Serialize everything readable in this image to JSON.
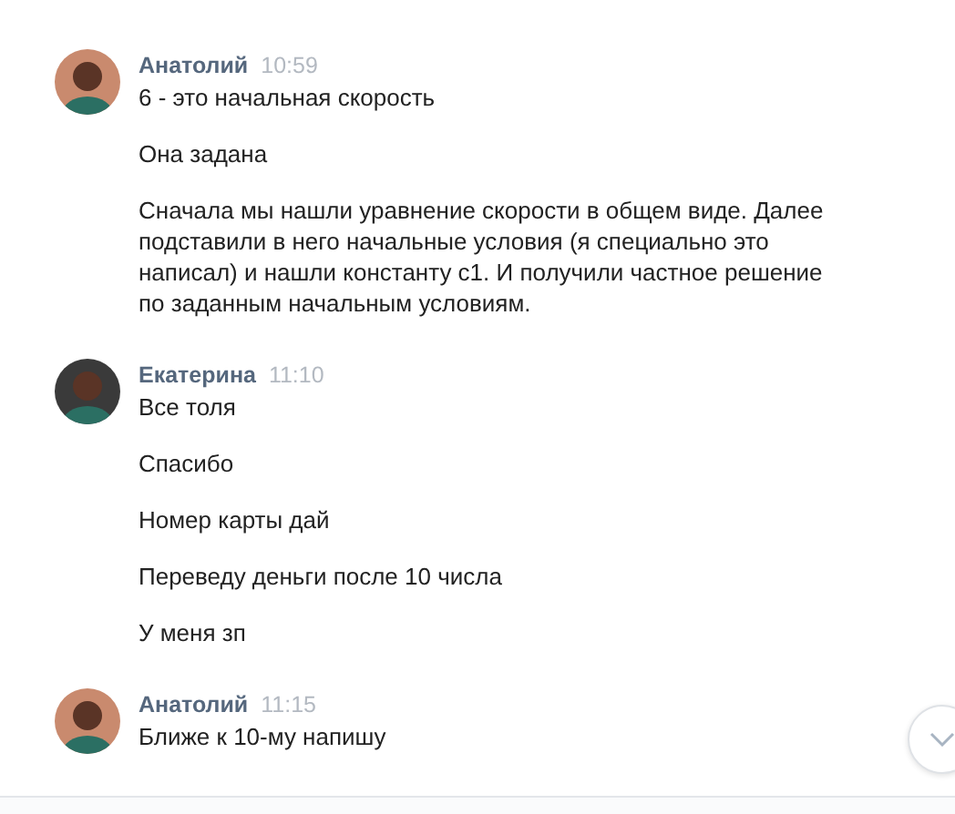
{
  "groups": [
    {
      "author": "Анатолий",
      "time": "10:59",
      "color": "#c98a6e",
      "messages": [
        "6 - это начальная скорость",
        "Она задана",
        "Сначала мы нашли уравнение скорости в общем виде. Далее подставили в него начальные условия (я специально это написал) и нашли константу с1. И получили частное решение по заданным начальным условиям."
      ]
    },
    {
      "author": "Екатерина",
      "time": "11:10",
      "color": "#3a3a3a",
      "messages": [
        "Все толя",
        "Спасибо",
        "Номер карты дай",
        "Переведу деньги после 10 числа",
        "У меня зп"
      ]
    },
    {
      "author": "Анатолий",
      "time": "11:15",
      "color": "#c98a6e",
      "messages": [
        "Ближе к 10-му напишу"
      ]
    }
  ]
}
